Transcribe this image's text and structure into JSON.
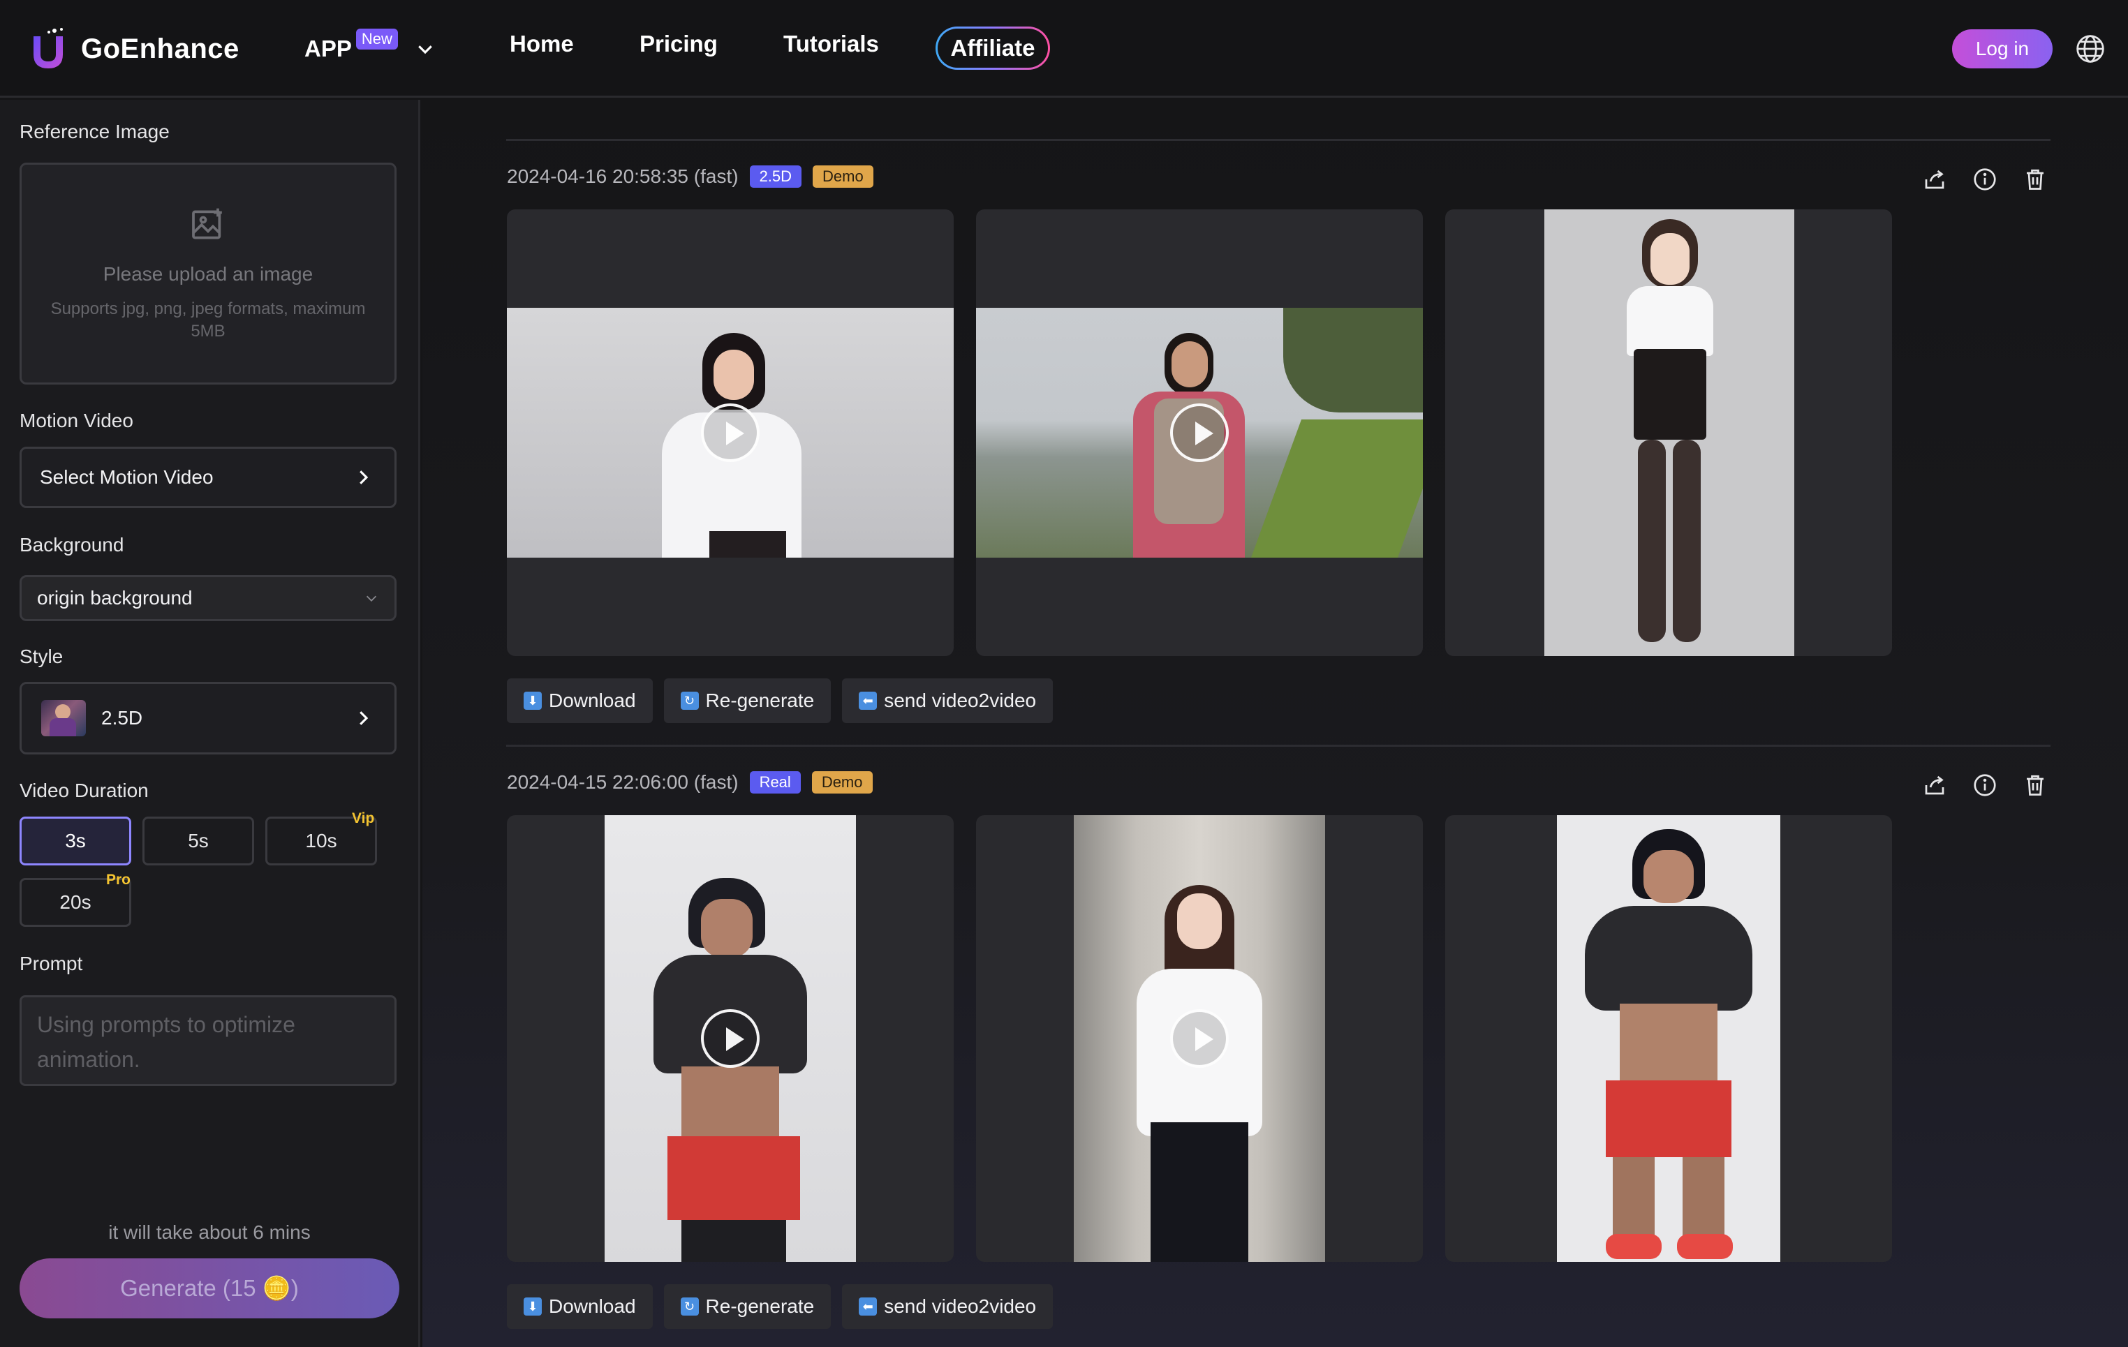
{
  "header": {
    "brand": "GoEnhance",
    "app_label": "APP",
    "new_badge": "New",
    "nav": [
      "Home",
      "Pricing",
      "Tutorials"
    ],
    "affiliate": "Affiliate",
    "login": "Log in"
  },
  "sidebar": {
    "reference_label": "Reference Image",
    "upload_text": "Please upload an image",
    "upload_hint": "Supports jpg, png, jpeg formats, maximum 5MB",
    "motion_label": "Motion Video",
    "motion_select": "Select Motion Video",
    "background_label": "Background",
    "background_value": "origin background",
    "style_label": "Style",
    "style_value": "2.5D",
    "duration_label": "Video Duration",
    "durations": [
      "3s",
      "5s",
      "10s",
      "20s"
    ],
    "vip_tag": "Vip",
    "pro_tag": "Pro",
    "prompt_label": "Prompt",
    "prompt_placeholder": "Using prompts to optimize animation.",
    "estimate": "it will take about 6 mins",
    "generate": "Generate (15 🪙)"
  },
  "generations": [
    {
      "timestamp": "2024-04-16 20:58:35 (fast)",
      "style_tag": "2.5D",
      "demo_tag": "Demo",
      "buttons": [
        "Download",
        "Re-generate",
        "send video2video"
      ]
    },
    {
      "timestamp": "2024-04-15 22:06:00 (fast)",
      "style_tag": "Real",
      "demo_tag": "Demo",
      "buttons": [
        "Download",
        "Re-generate",
        "send video2video"
      ]
    }
  ],
  "colors": {
    "accent": "#8e86ff",
    "tag_blue": "#5b5bf0",
    "tag_orange": "#e0a64a",
    "tier_gold": "#f4c431"
  },
  "icons": [
    "logo-icon",
    "chevron-down-icon",
    "globe-icon",
    "image-upload-icon",
    "chevron-right-icon",
    "share-icon",
    "info-icon",
    "trash-icon",
    "play-icon",
    "download-icon",
    "regenerate-icon",
    "send-icon"
  ]
}
